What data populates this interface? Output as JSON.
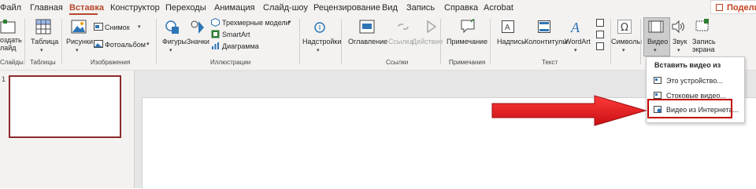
{
  "menu": {
    "tabs": [
      "Файл",
      "Главная",
      "Вставка",
      "Конструктор",
      "Переходы",
      "Анимация",
      "Слайд-шоу",
      "Рецензирование",
      "Вид",
      "Запись",
      "Справка",
      "Acrobat"
    ],
    "share_label": "Поделить"
  },
  "ribbon": {
    "slides": {
      "btn_line1": "оздать",
      "btn_line2": "лайд",
      "group": "Слайды"
    },
    "tables": {
      "btn": "Таблица",
      "group": "Таблицы"
    },
    "images": {
      "pictures": "Рисунки",
      "screenshot": "Снимок",
      "photoalbum": "Фотоальбом",
      "group": "Изображения"
    },
    "illustrations": {
      "shapes": "Фигуры",
      "icons": "Значки",
      "models3d": "Трехмерные модели",
      "smartart": "SmartArt",
      "chart": "Диаграмма",
      "group": "Иллюстрации"
    },
    "addins": {
      "btn": "Надстройки"
    },
    "links": {
      "outline": "Оглавление",
      "link": "Ссылка",
      "action": "Действие",
      "group": "Ссылки"
    },
    "comments": {
      "btn": "Примечание",
      "group": "Примечания"
    },
    "text": {
      "textbox": "Надпись",
      "headerfooter": "Колонтитулы",
      "wordart": "WordArt",
      "group": "Текст"
    },
    "symbols": {
      "btn": "Символы"
    },
    "media": {
      "video": "Видео",
      "audio": "Звук",
      "screenrec_line1": "Запись",
      "screenrec_line2": "экрана"
    }
  },
  "thumbnails": {
    "slide_number": "1"
  },
  "video_menu": {
    "title": "Вставить видео из",
    "items": [
      "Это устройство...",
      "Стоковые видео...",
      "Видео из Интернета..."
    ]
  },
  "colors": {
    "accent": "#b7472a",
    "highlight": "#c00000",
    "arrow": "#e8161b"
  }
}
